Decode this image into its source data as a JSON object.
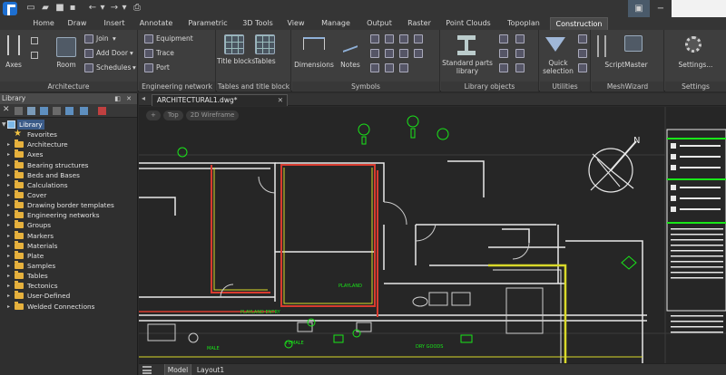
{
  "tabs": [
    "Home",
    "Draw",
    "Insert",
    "Annotate",
    "Parametric",
    "3D Tools",
    "View",
    "Manage",
    "Output",
    "Raster",
    "Point Clouds",
    "Topoplan",
    "Construction"
  ],
  "active_tab": "Construction",
  "ribbon": {
    "architecture": {
      "label": "Architecture",
      "axes": "Axes",
      "room": "Room",
      "join": "Join",
      "add_door": "Add Door",
      "schedules": "Schedules"
    },
    "engineering": {
      "label": "Engineering network",
      "equipment": "Equipment",
      "trace": "Trace",
      "port": "Port"
    },
    "tables": {
      "label": "Tables and title block",
      "title_blocks": "Title blocks",
      "tables": "Tables"
    },
    "symbols": {
      "label": "Symbols",
      "dimensions": "Dimensions",
      "notes": "Notes"
    },
    "library_objects": {
      "label": "Library objects",
      "standard_parts": "Standard parts library"
    },
    "utilities": {
      "label": "Utilities",
      "quick_selection": "Quick selection"
    },
    "meshwizard": {
      "label": "MeshWizard",
      "scriptmaster": "ScriptMaster"
    },
    "settings": {
      "label": "Settings",
      "settings": "Settings..."
    }
  },
  "library": {
    "title": "Library",
    "root": "Library",
    "items": [
      "Favorites",
      "Architecture",
      "Axes",
      "Bearing structures",
      "Beds and Bases",
      "Calculations",
      "Cover",
      "Drawing border templates",
      "Engineering networks",
      "Groups",
      "Markers",
      "Materials",
      "Plate",
      "Samples",
      "Tables",
      "Tectonics",
      "User-Defined",
      "Welded Connections"
    ]
  },
  "document": {
    "tab": "ARCHITECTURAL1.dwg*",
    "view_chips": [
      "Top",
      "2D Wireframe"
    ]
  },
  "drawing_labels": {
    "playland": "PLAYLAND",
    "playland_entry": "PLAYLAND ENTRY",
    "female": "FEMALE",
    "male": "MALE",
    "dry_goods": "DRY GOODS"
  },
  "layout_tabs": [
    "Model",
    "Layout1"
  ],
  "active_layout": "Model",
  "colors": {
    "accent_tab": "#4a4a4a",
    "canvas": "#262626",
    "symbol_green": "#19e619",
    "wall_red": "#d83b2f",
    "wall_yellow": "#d9d92a",
    "folder": "#e6b13d"
  }
}
